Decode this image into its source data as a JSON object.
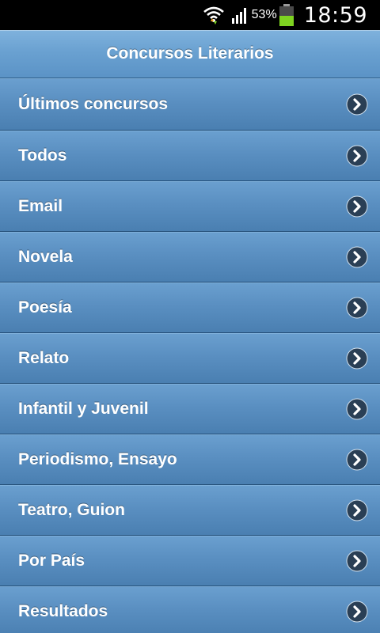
{
  "status_bar": {
    "battery_percent": "53%",
    "time": "18:59"
  },
  "header": {
    "title": "Concursos Literarios"
  },
  "menu": {
    "items": [
      {
        "label": "Últimos concursos"
      },
      {
        "label": "Todos"
      },
      {
        "label": "Email"
      },
      {
        "label": "Novela"
      },
      {
        "label": "Poesía"
      },
      {
        "label": "Relato"
      },
      {
        "label": "Infantil y Juvenil"
      },
      {
        "label": "Periodismo, Ensayo"
      },
      {
        "label": "Teatro, Guion"
      },
      {
        "label": "Por País"
      },
      {
        "label": "Resultados"
      }
    ]
  },
  "icons": {
    "wifi": "wifi-icon",
    "signal": "signal-icon",
    "battery": "battery-icon",
    "chevron": "chevron-right-icon"
  },
  "colors": {
    "header_top": "#7fb2dd",
    "item_mid": "#5a8fc1",
    "battery_green": "#7ed321"
  }
}
